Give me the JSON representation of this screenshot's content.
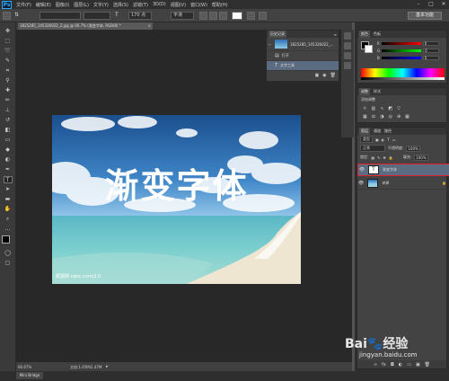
{
  "app": {
    "logo": "Ps"
  },
  "menu": [
    "文件(F)",
    "编辑(E)",
    "图像(I)",
    "图层(L)",
    "文字(Y)",
    "选择(S)",
    "滤镜(T)",
    "3D(D)",
    "视图(V)",
    "窗口(W)",
    "帮助(H)"
  ],
  "window_controls": [
    "–",
    "□",
    "✕"
  ],
  "options": {
    "font_size": "170 点",
    "antialias": "平滑",
    "workspace": "基本功能"
  },
  "document": {
    "tab_title": "1825285_145326022_2.jpg @ 66.7% (渐变字体, RGB/8) *",
    "tab_close": "×",
    "image_text": "渐变字体",
    "image_watermark": "昵图网 nipic.com/2.0",
    "zoom": "66.67%",
    "file_info": "文档:1.05M/2.47M"
  },
  "bottom_tab": "Mini Bridge",
  "history": {
    "title": "历史记录",
    "snapshot": "1825285_145326022_...",
    "items": [
      "打开",
      "文字工具"
    ]
  },
  "color": {
    "tabs": [
      "颜色",
      "色板"
    ],
    "r": "0",
    "g": "0",
    "b": "0",
    "fg": "#000000",
    "bg": "#ffffff"
  },
  "adjustments": {
    "tabs": [
      "调整",
      "样式"
    ],
    "title": "添加调整"
  },
  "layers": {
    "tabs": [
      "图层",
      "通道",
      "路径"
    ],
    "filter_label": "类型",
    "blend_mode": "正常",
    "opacity_label": "不透明度:",
    "opacity": "100%",
    "lock_label": "锁定:",
    "fill_label": "填充:",
    "fill": "100%",
    "items": [
      {
        "name": "渐变字体",
        "type": "T",
        "selected": true
      },
      {
        "name": "背景",
        "type": "image",
        "selected": false
      }
    ]
  },
  "watermark": {
    "brand": "Bai",
    "brand2": "经验",
    "url": "jingyan.baidu.com"
  }
}
